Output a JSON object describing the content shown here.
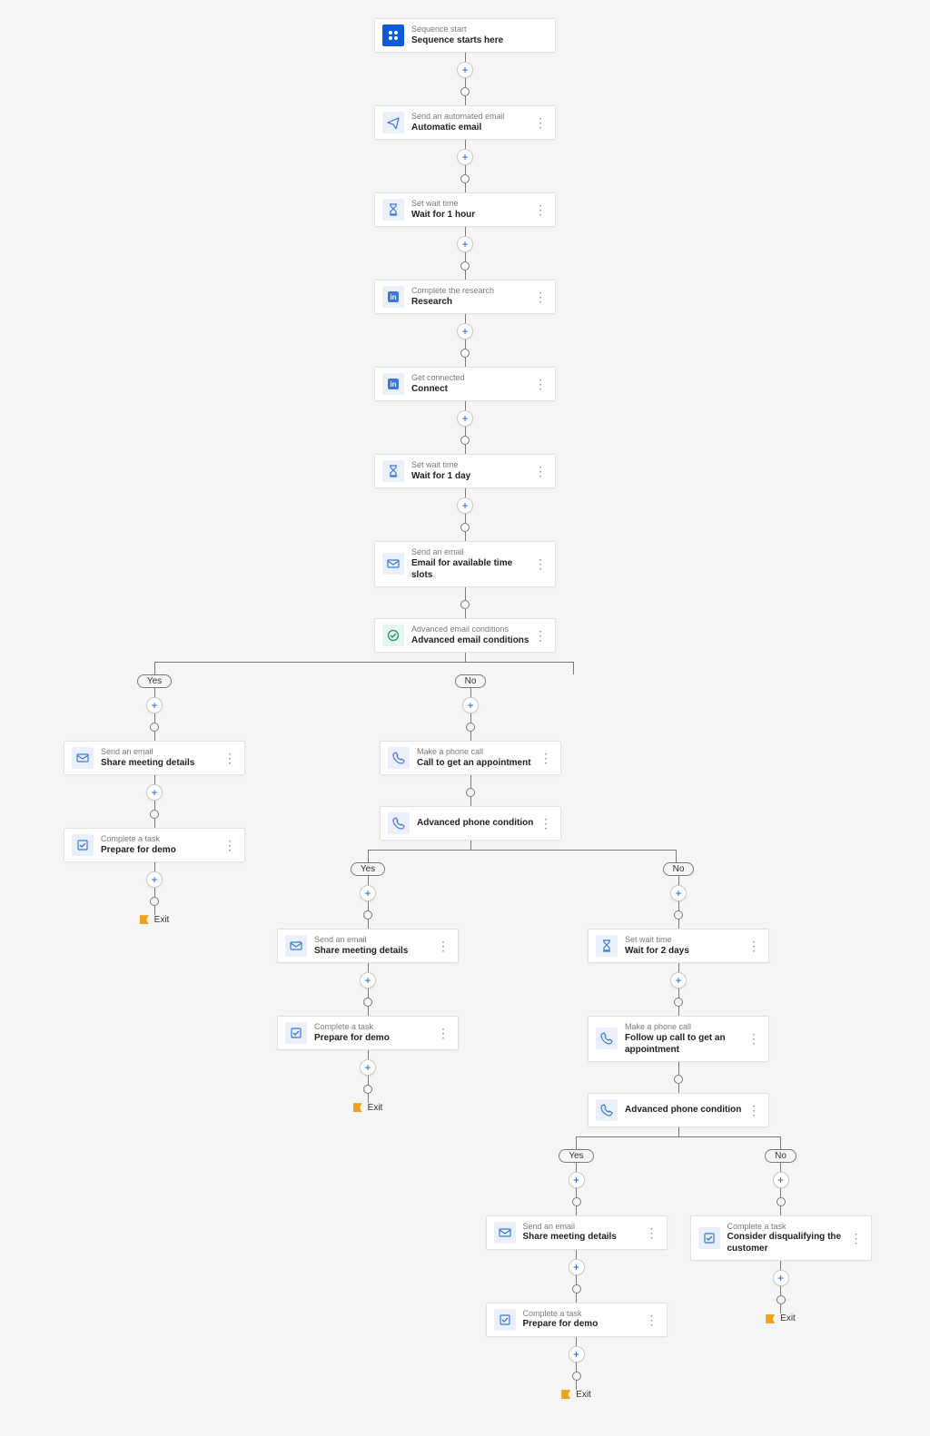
{
  "labels": {
    "yes": "Yes",
    "no": "No",
    "exit": "Exit"
  },
  "nodes": {
    "start": {
      "label": "Sequence start",
      "title": "Sequence starts here",
      "icon": "start"
    },
    "auto_email": {
      "label": "Send an automated email",
      "title": "Automatic email",
      "icon": "email"
    },
    "wait1h": {
      "label": "Set wait time",
      "title": "Wait for 1 hour",
      "icon": "wait"
    },
    "research": {
      "label": "Complete the research",
      "title": "Research",
      "icon": "linkedin"
    },
    "connect": {
      "label": "Get connected",
      "title": "Connect",
      "icon": "linkedin"
    },
    "wait1d": {
      "label": "Set wait time",
      "title": "Wait for 1 day",
      "icon": "wait"
    },
    "email_slots": {
      "label": "Send an email",
      "title": "Email for available time slots",
      "icon": "email"
    },
    "cond_email": {
      "label": "Advanced email conditions",
      "title": "Advanced email conditions",
      "icon": "cond"
    },
    "share_meeting_1": {
      "label": "Send an email",
      "title": "Share meeting details",
      "icon": "email"
    },
    "prepare_demo_1": {
      "label": "Complete a task",
      "title": "Prepare for demo",
      "icon": "task"
    },
    "call_apt": {
      "label": "Make a phone call",
      "title": "Call to get an appointment",
      "icon": "phone"
    },
    "cond_phone_1": {
      "label": "",
      "title": "Advanced phone condition",
      "icon": "phone"
    },
    "share_meeting_2": {
      "label": "Send an email",
      "title": "Share meeting details",
      "icon": "email"
    },
    "prepare_demo_2": {
      "label": "Complete a task",
      "title": "Prepare for demo",
      "icon": "task"
    },
    "wait2d": {
      "label": "Set wait time",
      "title": "Wait for 2 days",
      "icon": "wait"
    },
    "followup_call": {
      "label": "Make a phone call",
      "title": "Follow up call to get an appointment",
      "icon": "phone"
    },
    "cond_phone_2": {
      "label": "",
      "title": "Advanced phone condition",
      "icon": "phone"
    },
    "share_meeting_3": {
      "label": "Send an email",
      "title": "Share meeting details",
      "icon": "email"
    },
    "prepare_demo_3": {
      "label": "Complete a task",
      "title": "Prepare for demo",
      "icon": "task"
    },
    "disqualify": {
      "label": "Complete a task",
      "title": "Consider disqualifying the customer",
      "icon": "task"
    }
  }
}
